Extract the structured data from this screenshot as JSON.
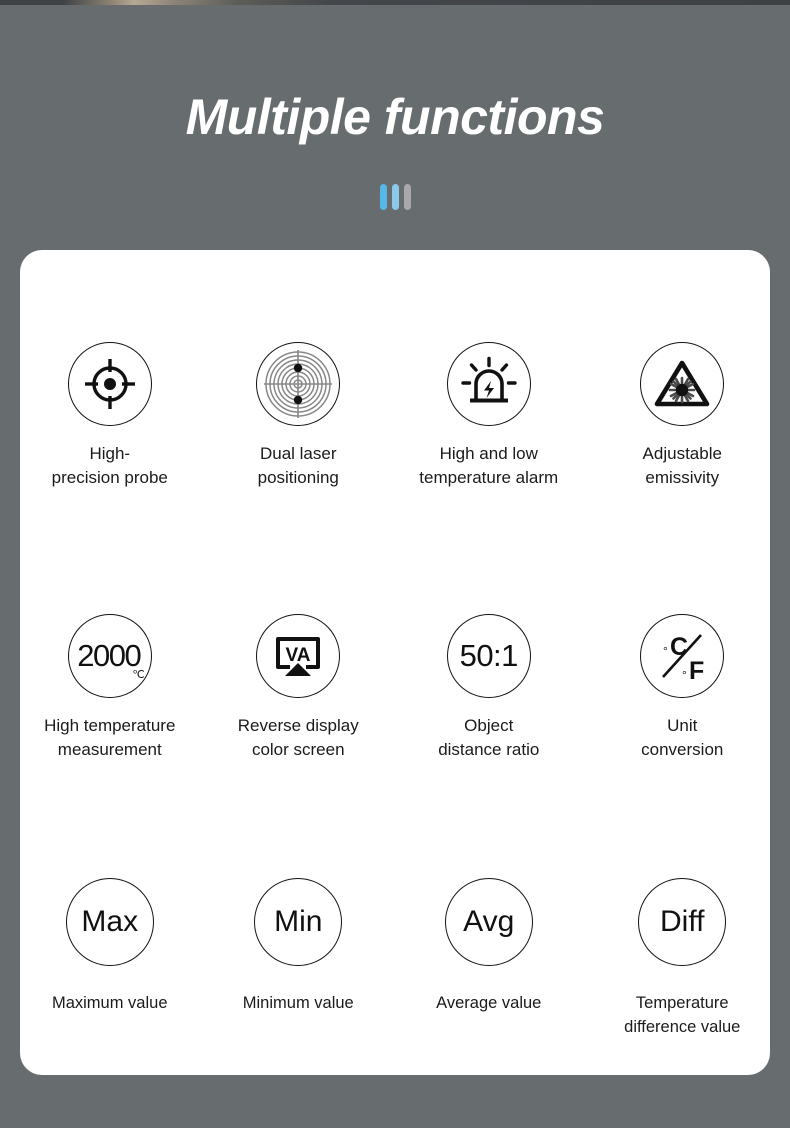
{
  "header": {
    "title": "Multiple functions",
    "accent_blue": "#56b8e6",
    "accent_blue_light": "#8cc8e8",
    "accent_gray": "#a7a9ab",
    "background": "#676c6f",
    "bars": [
      {
        "name": "bar-blue",
        "color": "#56b8e6"
      },
      {
        "name": "bar-blue-light",
        "color": "#8cc8e8"
      },
      {
        "name": "bar-gray",
        "color": "#a7a9ab"
      }
    ]
  },
  "card": {
    "background": "#ffffff",
    "rows": [
      {
        "features": [
          {
            "icon": "crosshair-target-icon",
            "glyph": "",
            "caption": "High-\nprecision probe"
          },
          {
            "icon": "concentric-laser-rings-icon",
            "glyph": "",
            "caption": "Dual laser\npositioning"
          },
          {
            "icon": "alarm-siren-icon",
            "glyph": "",
            "caption": "High and low\ntemperature alarm"
          },
          {
            "icon": "laser-warning-triangle-icon",
            "glyph": "",
            "caption": "Adjustable\nemissivity"
          }
        ]
      },
      {
        "features": [
          {
            "icon": "text-2000-celsius-icon",
            "glyph": "2000",
            "glyph_sup": "℃",
            "caption": "High temperature\nmeasurement"
          },
          {
            "icon": "reverse-display-screen-icon",
            "glyph": "VA",
            "caption": "Reverse display\ncolor screen"
          },
          {
            "icon": "text-ratio-icon",
            "glyph": "50:1",
            "caption": "Object\ndistance ratio"
          },
          {
            "icon": "celsius-fahrenheit-icon",
            "glyph": "°C/°F",
            "caption": "Unit\nconversion"
          }
        ]
      },
      {
        "features": [
          {
            "icon": "text-max-icon",
            "glyph": "Max",
            "caption": "Maximum value"
          },
          {
            "icon": "text-min-icon",
            "glyph": "Min",
            "caption": "Minimum value"
          },
          {
            "icon": "text-avg-icon",
            "glyph": "Avg",
            "caption": "Average value"
          },
          {
            "icon": "text-diff-icon",
            "glyph": "Diff",
            "caption": "Temperature\ndifference value"
          }
        ]
      }
    ]
  }
}
